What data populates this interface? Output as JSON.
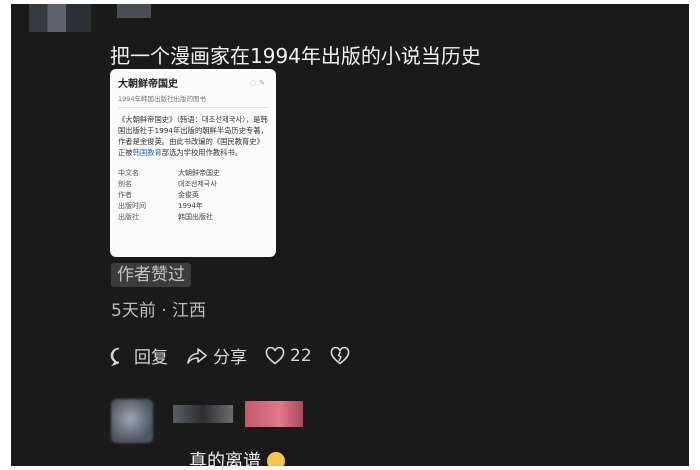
{
  "post": {
    "title": "把一个漫画家在1994年出版的小说当历史",
    "author_badge": "作者赞过",
    "meta": "5天前 · 江西"
  },
  "card": {
    "title": "大朝鲜帝国史",
    "subtitle": "1994年韩国出版社出版的图书",
    "desc_part1": "《大朝鲜帝国史》（韩语：대조선제국사），是韩国出版社于1994年出版的朝鲜半岛历史专著，作者是金俊英。由此书改编的《国民教育史》正被",
    "desc_link": "韩国教育",
    "desc_part2": "部选为学校用作教科书。",
    "info": [
      {
        "key": "中文名",
        "value": "大朝鲜帝国史"
      },
      {
        "key": "别名",
        "value": "대조선제국사"
      },
      {
        "key": "作者",
        "value": "金俊英"
      },
      {
        "key": "出版时间",
        "value": "1994年"
      },
      {
        "key": "出版社",
        "value": "韩国出版社"
      }
    ]
  },
  "actions": {
    "reply": "回复",
    "share": "分享",
    "likes": "22"
  },
  "comment": {
    "text": "真的离谱"
  },
  "icons": [
    "reply-icon",
    "share-icon",
    "heart-icon",
    "dislike-icon",
    "laugh-emoji-icon"
  ],
  "colors": {
    "background": "#1a1a1a",
    "text": "#f2f2f2",
    "badge_bg": "#3c3c3c",
    "link": "#2f64d6"
  }
}
